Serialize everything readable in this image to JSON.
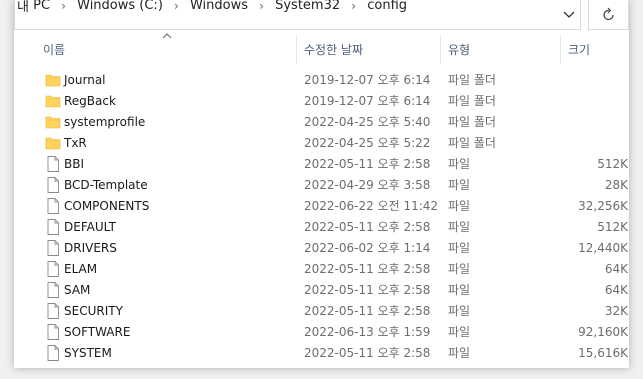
{
  "address": {
    "crumbs": [
      "PC",
      "Windows (C:)",
      "Windows",
      "System32",
      "config"
    ],
    "prefix_glyph": "내"
  },
  "columns": {
    "name": "이름",
    "date": "수정한 날짜",
    "type": "유형",
    "size": "크기"
  },
  "files": [
    {
      "name": "Journal",
      "date": "2019-12-07 오후 6:14",
      "type": "파일 폴더",
      "size": "",
      "kind": "folder"
    },
    {
      "name": "RegBack",
      "date": "2019-12-07 오후 6:14",
      "type": "파일 폴더",
      "size": "",
      "kind": "folder"
    },
    {
      "name": "systemprofile",
      "date": "2022-04-25 오후 5:40",
      "type": "파일 폴더",
      "size": "",
      "kind": "folder"
    },
    {
      "name": "TxR",
      "date": "2022-04-25 오후 5:22",
      "type": "파일 폴더",
      "size": "",
      "kind": "folder"
    },
    {
      "name": "BBI",
      "date": "2022-05-11 오후 2:58",
      "type": "파일",
      "size": "512K",
      "kind": "file"
    },
    {
      "name": "BCD-Template",
      "date": "2022-04-29 오후 3:58",
      "type": "파일",
      "size": "28K",
      "kind": "file"
    },
    {
      "name": "COMPONENTS",
      "date": "2022-06-22 오전 11:42",
      "type": "파일",
      "size": "32,256K",
      "kind": "file"
    },
    {
      "name": "DEFAULT",
      "date": "2022-05-11 오후 2:58",
      "type": "파일",
      "size": "512K",
      "kind": "file"
    },
    {
      "name": "DRIVERS",
      "date": "2022-06-02 오후 1:14",
      "type": "파일",
      "size": "12,440K",
      "kind": "file"
    },
    {
      "name": "ELAM",
      "date": "2022-05-11 오후 2:58",
      "type": "파일",
      "size": "64K",
      "kind": "file"
    },
    {
      "name": "SAM",
      "date": "2022-05-11 오후 2:58",
      "type": "파일",
      "size": "64K",
      "kind": "file"
    },
    {
      "name": "SECURITY",
      "date": "2022-05-11 오후 2:58",
      "type": "파일",
      "size": "32K",
      "kind": "file"
    },
    {
      "name": "SOFTWARE",
      "date": "2022-06-13 오후 1:59",
      "type": "파일",
      "size": "92,160K",
      "kind": "file"
    },
    {
      "name": "SYSTEM",
      "date": "2022-05-11 오후 2:58",
      "type": "파일",
      "size": "15,616K",
      "kind": "file"
    }
  ],
  "icons": {
    "folder": "folder-icon",
    "file": "file-icon",
    "refresh": "refresh-icon",
    "dropdown": "chevron-down-icon",
    "sort": "sort-ascending-icon"
  },
  "colors": {
    "folder": "#ffd35c",
    "header_text": "#4d5f7a",
    "secondary_text": "#6d6d6d"
  }
}
